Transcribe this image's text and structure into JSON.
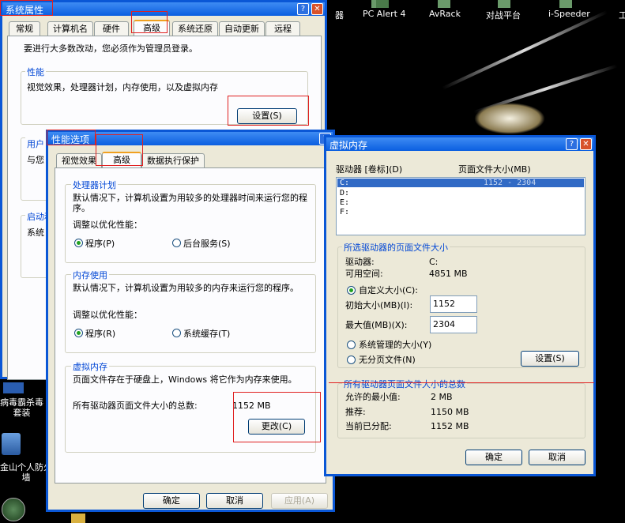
{
  "desktop": {
    "top_icons": [
      {
        "label": "器"
      },
      {
        "label": "PC Alert 4"
      },
      {
        "label": "AvRack"
      },
      {
        "label": "对战平台"
      },
      {
        "label": "i-Speeder"
      },
      {
        "label": "工"
      }
    ],
    "left_icons": [
      {
        "label": "病毒霸杀毒\n套装"
      },
      {
        "label": "金山个人防火\n墙"
      }
    ]
  },
  "sysprops": {
    "title": "系统属性",
    "tabs": [
      "常规",
      "计算机名",
      "硬件",
      "高级",
      "系统还原",
      "自动更新",
      "远程"
    ],
    "active_tab": "高级",
    "admin_note": "要进行大多数改动，您必须作为管理员登录。",
    "perf_group": "性能",
    "perf_desc": "视觉效果，处理器计划，内存使用，以及虚拟内存",
    "settings_btn": "设置(S)",
    "user_group": "用户",
    "user_desc": "与您",
    "startup_group": "启动和",
    "startup_desc": "系统"
  },
  "perfopts": {
    "title": "性能选项",
    "tabs": [
      "视觉效果",
      "高级",
      "数据执行保护"
    ],
    "active_tab": "高级",
    "cpu_group": "处理器计划",
    "cpu_desc": "默认情况下，计算机设置为用较多的处理器时间来运行您的程序。",
    "cpu_adjust": "调整以优化性能：",
    "cpu_opt1": "程序(P)",
    "cpu_opt2": "后台服务(S)",
    "cpu_selected": "程序(P)",
    "mem_group": "内存使用",
    "mem_desc": "默认情况下，计算机设置为用较多的内存来运行您的程序。",
    "mem_adjust": "调整以优化性能：",
    "mem_opt1": "程序(R)",
    "mem_opt2": "系统缓存(T)",
    "mem_selected": "程序(R)",
    "vm_group": "虚拟内存",
    "vm_desc": "页面文件存在于硬盘上，Windows 将它作为内存来使用。",
    "vm_total_label": "所有驱动器页面文件大小的总数:",
    "vm_total_value": "1152 MB",
    "change_btn": "更改(C)",
    "ok_btn": "确定",
    "cancel_btn": "取消",
    "apply_btn": "应用(A)"
  },
  "vmem": {
    "title": "虚拟内存",
    "col_drive": "驱动器 [卷标](D)",
    "col_size": "页面文件大小(MB)",
    "drives": [
      {
        "drive": "C:",
        "size": "1152 - 2304"
      },
      {
        "drive": "D:",
        "size": ""
      },
      {
        "drive": "E:",
        "size": ""
      },
      {
        "drive": "F:",
        "size": ""
      }
    ],
    "selected_group": "所选驱动器的页面文件大小",
    "drive_label": "驱动器:",
    "drive_value": "C:",
    "free_label": "可用空间:",
    "free_value": "4851 MB",
    "custom_size": "自定义大小(C):",
    "initial_label": "初始大小(MB)(I):",
    "initial_value": "1152",
    "max_label": "最大值(MB)(X):",
    "max_value": "2304",
    "system_managed": "系统管理的大小(Y)",
    "no_pagefile": "无分页文件(N)",
    "selected_option": "自定义大小(C):",
    "set_btn": "设置(S)",
    "total_group": "所有驱动器页面文件大小的总数",
    "min_label": "允许的最小值:",
    "min_value": "2 MB",
    "rec_label": "推荐:",
    "rec_value": "1150 MB",
    "cur_label": "当前已分配:",
    "cur_value": "1152 MB",
    "ok_btn": "确定",
    "cancel_btn": "取消"
  },
  "colors": {
    "titlebar": "#0a5ee0",
    "dialog_bg": "#ece9d8",
    "group_label": "#0046d5",
    "highlight_box": "#e02020",
    "selection": "#316ac5"
  }
}
